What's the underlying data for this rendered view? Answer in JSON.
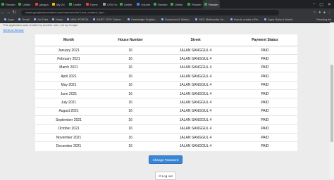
{
  "browser": {
    "tabs": [
      {
        "label": "Resider",
        "color": "#34a853"
      },
      {
        "label": "Untitle",
        "color": "#34a853"
      },
      {
        "label": "jawapa",
        "color": "#ea4335"
      },
      {
        "label": "My Dri",
        "color": "#fbbc04"
      },
      {
        "label": "Untitle",
        "color": "#34a853"
      },
      {
        "label": "Home",
        "color": "#ea4335"
      },
      {
        "label": "CSS Ho",
        "color": "#9aa0a6"
      },
      {
        "label": "Untitle",
        "color": "#34a853"
      },
      {
        "label": "Volume",
        "color": "#4285f4"
      },
      {
        "label": "Resider",
        "color": "#34a853"
      },
      {
        "label": "Untitle",
        "color": "#34a853"
      },
      {
        "label": "Resider",
        "color": "#34a853"
      },
      {
        "label": "Resider",
        "color": "#34a853",
        "active": true
      }
    ],
    "url": "script.googleusercontent.com/macros/echo?user_content_key=...",
    "bookmarks": [
      "Apps",
      "Gmail",
      "YouTube",
      "Maps",
      "MMU PORTAL",
      "MUET 2570 Tuition...",
      "Cambridge English...",
      "Download & Watch...",
      "SRC Multimedia Un...",
      "How to create a Re...",
      "Apps Script | Watch..."
    ],
    "reading_list": "Reading list"
  },
  "notice": "This application was created by another user, not by Google.",
  "terms": "Terms of Service",
  "table": {
    "headers": [
      "Month",
      "House Number",
      "Street",
      "Payment Status"
    ],
    "rows": [
      [
        "January 2021",
        "16",
        "JALAN SANGGUL 4",
        "PAID"
      ],
      [
        "February 2021",
        "16",
        "JALAN SANGGUL 4",
        "PAID"
      ],
      [
        "March 2021",
        "16",
        "JALAN SANGGUL 4",
        "PAID"
      ],
      [
        "April 2021",
        "16",
        "JALAN SANGGUL 4",
        "PAID"
      ],
      [
        "May 2021",
        "16",
        "JALAN SANGGUL 4",
        "PAID"
      ],
      [
        "June 2021",
        "16",
        "JALAN SANGGUL 4",
        "PAID"
      ],
      [
        "July 2021",
        "16",
        "JALAN SANGGUL 4",
        "PAID"
      ],
      [
        "August 2021",
        "16",
        "JALAN SANGGUL 4",
        "PAID"
      ],
      [
        "September 2021",
        "16",
        "JALAN SANGGUL 4",
        "PAID"
      ],
      [
        "October 2021",
        "16",
        "JALAN SANGGUL 4",
        "PAID"
      ],
      [
        "November 2021",
        "16",
        "JALAN SANGGUL 4",
        "PAID"
      ],
      [
        "December 2021",
        "16",
        "JALAN SANGGUL 4",
        "PAID"
      ]
    ]
  },
  "buttons": {
    "change_password": "Change Password",
    "logout": "Log out"
  }
}
